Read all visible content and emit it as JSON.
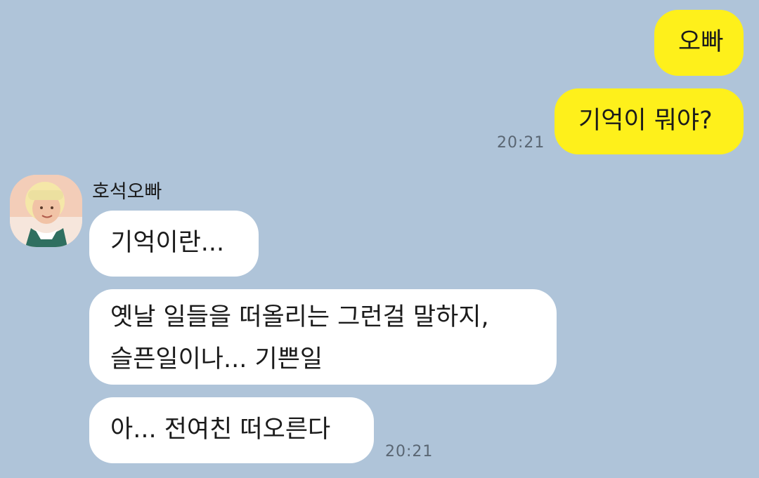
{
  "theme": {
    "background": "#afc4d9",
    "my_bubble": "#fef01b",
    "other_bubble": "#ffffff"
  },
  "messages_sent": [
    {
      "text": "오빠"
    },
    {
      "text": "기억이 뭐야?"
    }
  ],
  "sent_time": "20:21",
  "sender": {
    "name": "호석오빠",
    "avatar_icon": "profile-photo-icon"
  },
  "messages_received": [
    {
      "text": "기억이란..."
    },
    {
      "text": "옛날 일들을 떠올리는 그런걸 말하지,\n슬픈일이나... 기쁜일"
    },
    {
      "text": "아... 전여친 떠오른다"
    }
  ],
  "received_time": "20:21"
}
